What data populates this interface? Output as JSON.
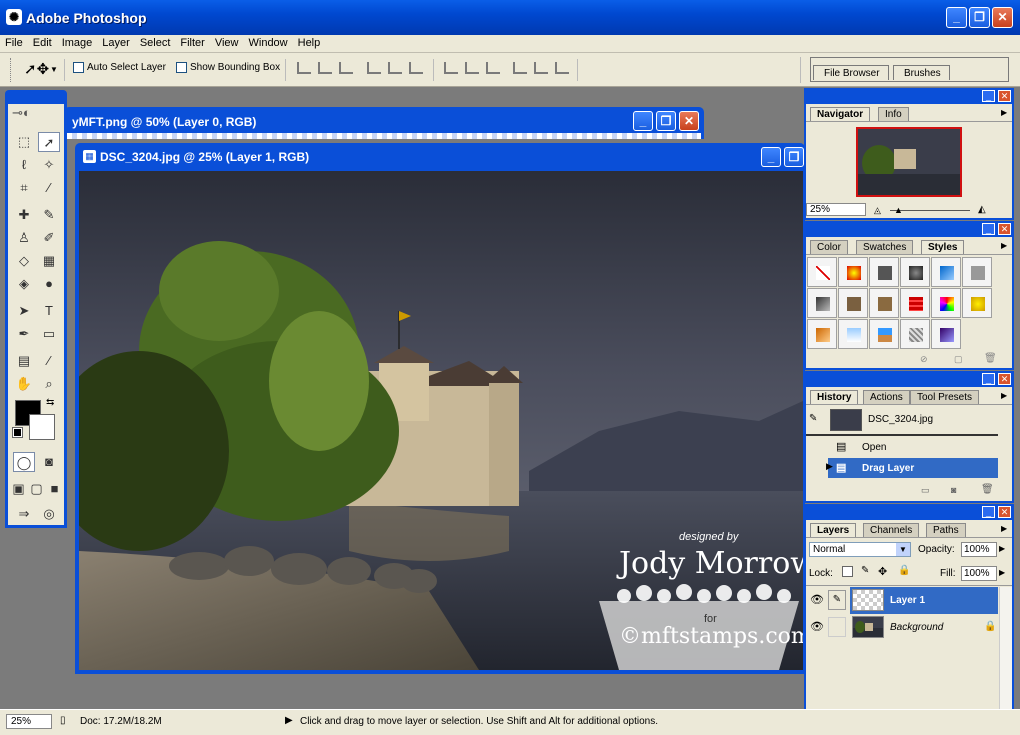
{
  "app": {
    "title": "Adobe Photoshop",
    "icon": "photoshop-icon"
  },
  "menu": [
    "File",
    "Edit",
    "Image",
    "Layer",
    "Select",
    "Filter",
    "View",
    "Window",
    "Help"
  ],
  "options": {
    "auto_select": "Auto Select Layer",
    "bounding_box": "Show Bounding Box"
  },
  "well": {
    "file_browser": "File Browser",
    "brushes": "Brushes"
  },
  "doc_back": {
    "title": "yMFT.png @ 50% (Layer 0, RGB)"
  },
  "doc_front": {
    "title": "DSC_3204.jpg @ 25% (Layer 1, RGB)"
  },
  "watermark": {
    "line1": "designed by",
    "line2": "Jody Morrow",
    "line3": "for",
    "line4": "©mftstamps.com"
  },
  "navigator": {
    "tabs": [
      "Navigator",
      "Info"
    ],
    "zoom": "25%"
  },
  "styles_palette": {
    "tabs": [
      "Color",
      "Swatches",
      "Styles"
    ]
  },
  "history": {
    "tabs": [
      "History",
      "Actions",
      "Tool Presets"
    ],
    "snapshot": "DSC_3204.jpg",
    "items": [
      "Open",
      "Drag Layer"
    ]
  },
  "layers": {
    "tabs": [
      "Layers",
      "Channels",
      "Paths"
    ],
    "blend_mode": "Normal",
    "opacity_label": "Opacity:",
    "opacity": "100%",
    "lock_label": "Lock:",
    "fill_label": "Fill:",
    "fill": "100%",
    "rows": [
      "Layer 1",
      "Background"
    ]
  },
  "status": {
    "zoom": "25%",
    "doc": "Doc: 17.2M/18.2M",
    "hint": "Click and drag to move layer or selection.  Use Shift and Alt for additional options."
  },
  "colors": {
    "xp_blue": "#0a4fd8",
    "panel": "#ece9d8",
    "selection": "#316ac5"
  }
}
